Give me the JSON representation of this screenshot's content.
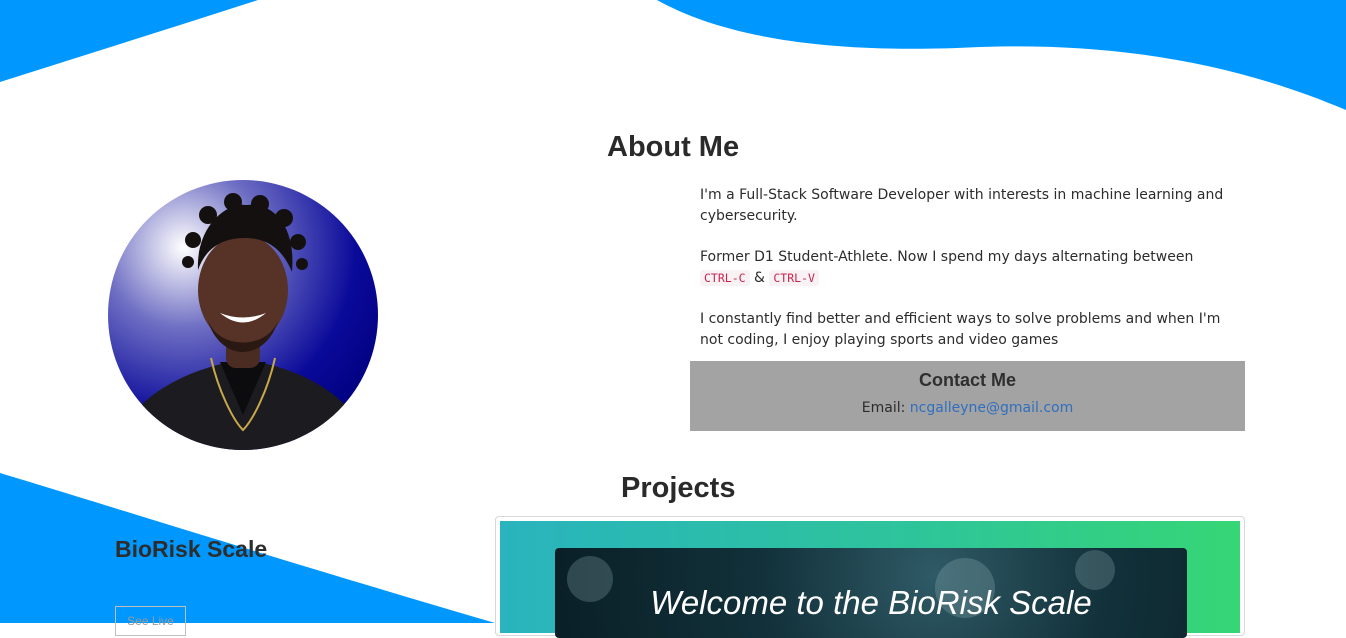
{
  "about": {
    "title": "About Me",
    "paragraph1": "I'm a Full-Stack Software Developer with interests in machine learning and cybersecurity.",
    "paragraph2_prefix": "Former D1 Student-Athlete. Now I spend my days alternating between",
    "paragraph2_key1": "CTRL-C",
    "paragraph2_amp": "&",
    "paragraph2_key2": "CTRL-V",
    "paragraph3": "I constantly find better and efficient ways to solve problems and when I'm not coding, I enjoy playing sports and video games"
  },
  "contact": {
    "title": "Contact Me",
    "email_label": "Email:",
    "email": "ncgalleyne@gmail.com"
  },
  "projects": {
    "title": "Projects",
    "items": [
      {
        "name": "BioRisk Scale",
        "button_label": "See Live",
        "image_headline": "Welcome to the BioRisk Scale"
      }
    ]
  },
  "colors": {
    "wave_blue": "#0098ff",
    "contact_bg": "#a3a3a3",
    "link": "#2f6fc0",
    "code_text": "#c7254e"
  }
}
